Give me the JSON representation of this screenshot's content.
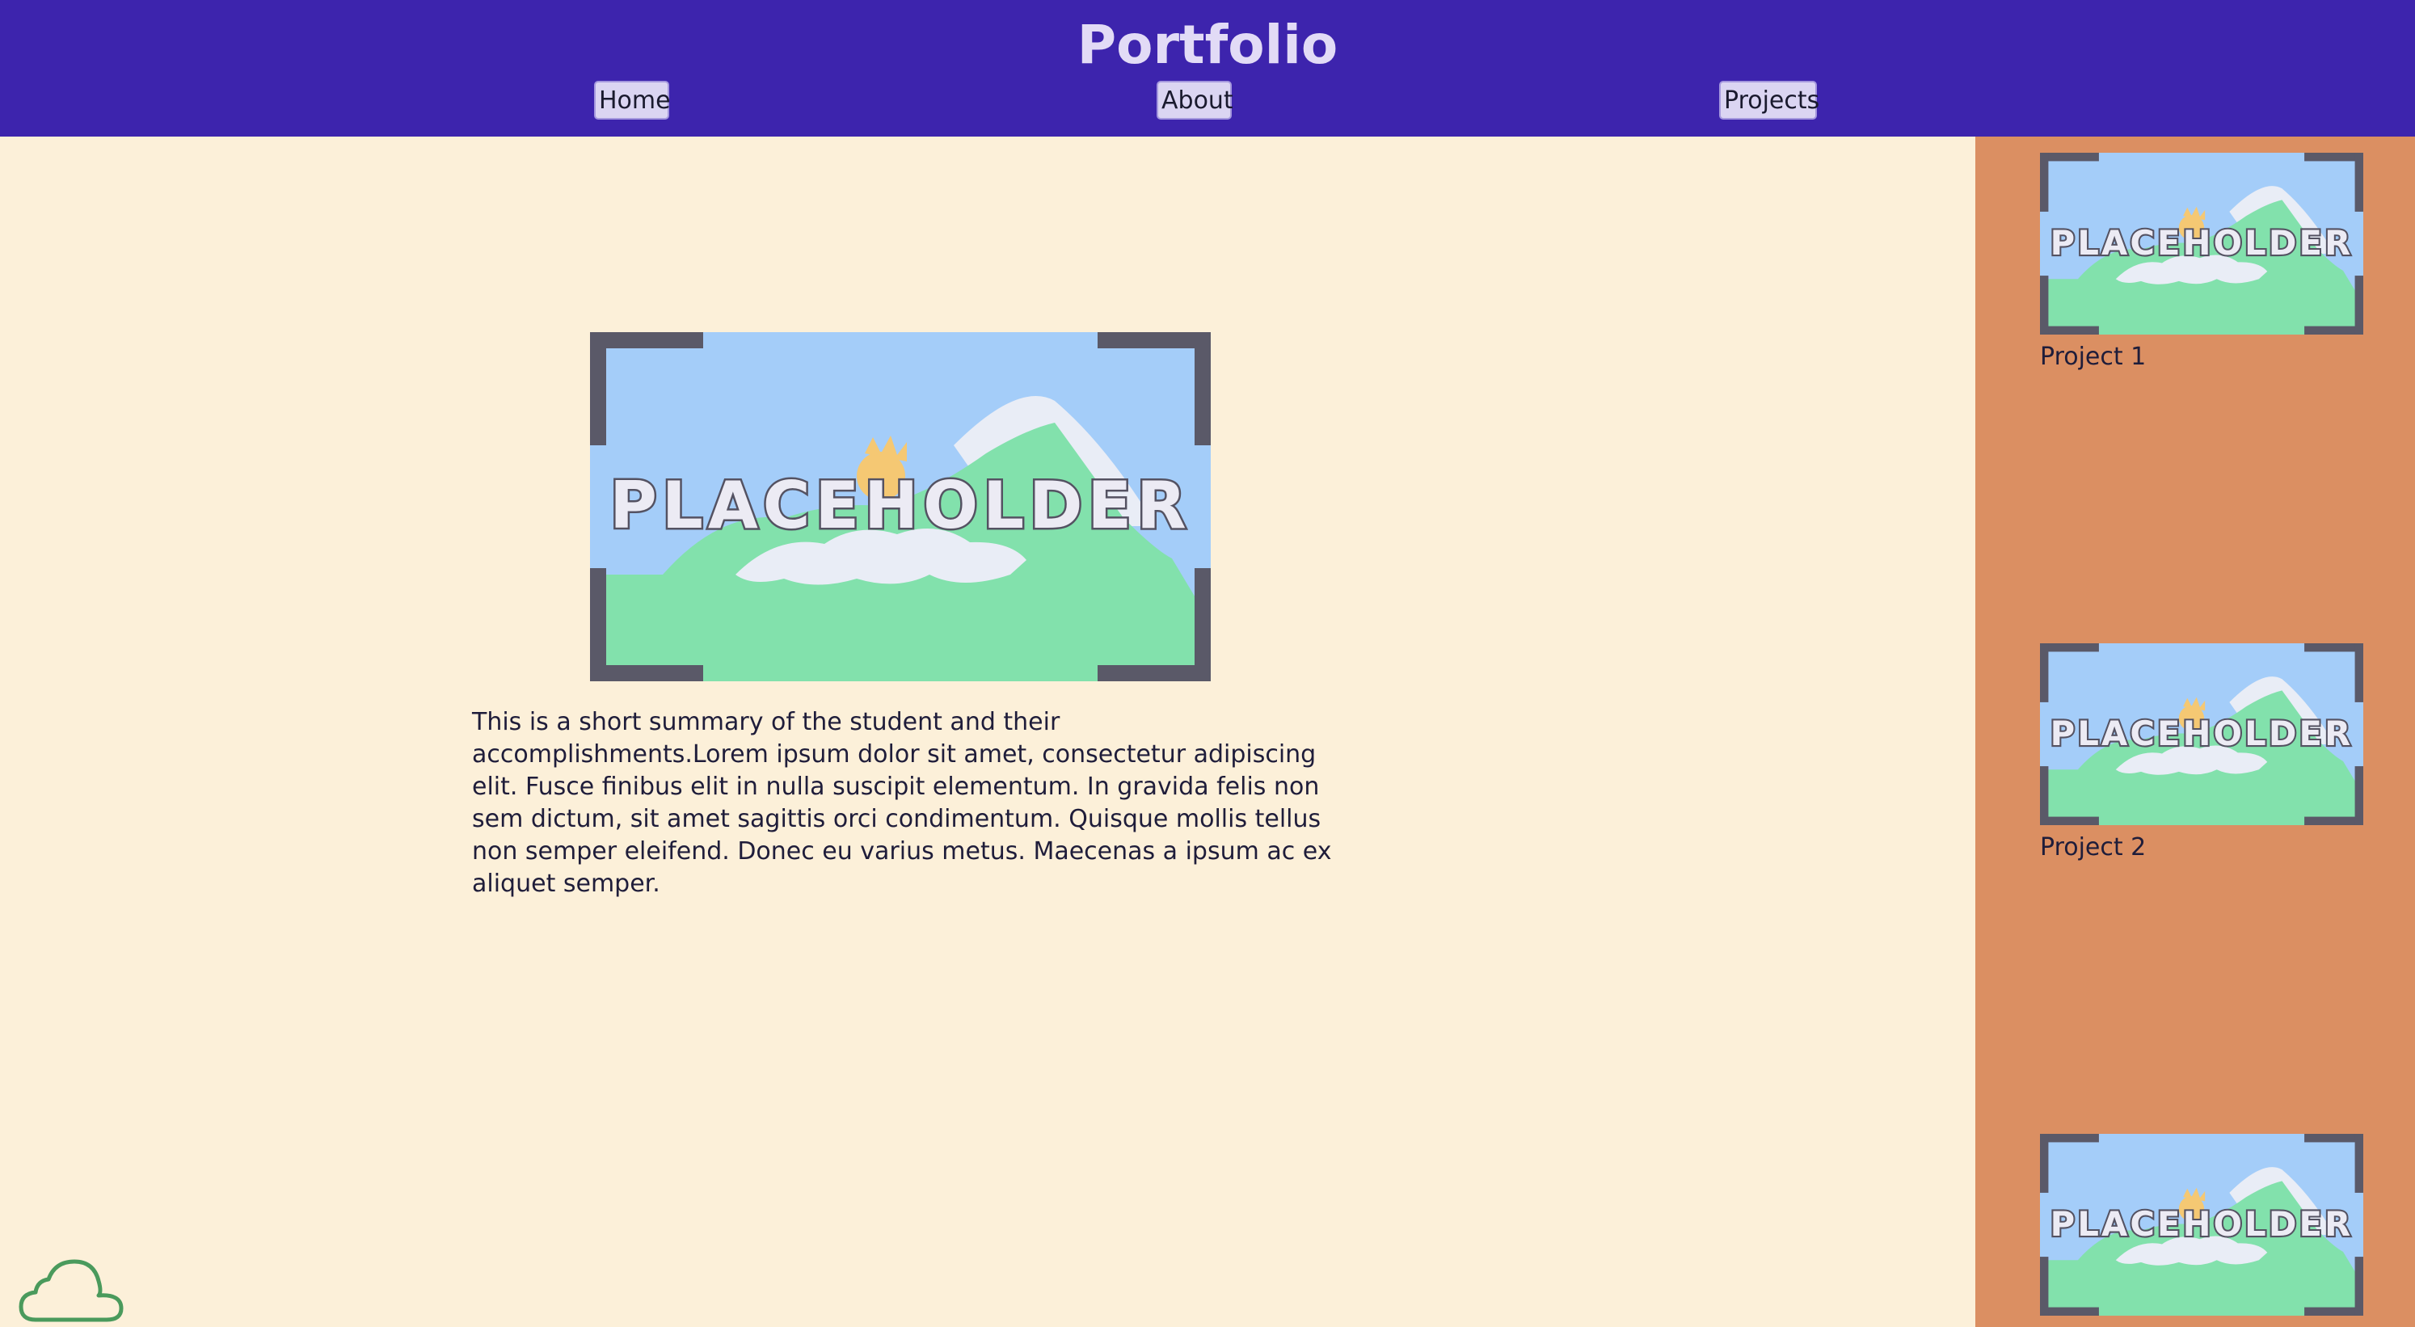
{
  "header": {
    "title": "Portfolio",
    "nav": [
      {
        "label": "Home"
      },
      {
        "label": "About"
      },
      {
        "label": "Projects"
      }
    ]
  },
  "main": {
    "hero_image_text": "PLACEHOLDER",
    "summary": "This is a short summary of the student and their accomplishments.Lorem ipsum dolor sit amet, consectetur adipiscing elit. Fusce finibus elit in nulla suscipit elementum. In gravida felis non sem dictum, sit amet sagittis orci condimentum. Quisque mollis tellus non semper eleifend. Donec eu varius metus. Maecenas a ipsum ac ex aliquet semper."
  },
  "sidebar": {
    "projects": [
      {
        "label": "Project 1",
        "image_text": "PLACEHOLDER"
      },
      {
        "label": "Project 2",
        "image_text": "PLACEHOLDER"
      },
      {
        "label": "",
        "image_text": "PLACEHOLDER"
      }
    ]
  },
  "colors": {
    "header_bg": "#3d24ad",
    "main_bg": "#fcf0d9",
    "sidebar_bg": "#db8f62",
    "title_text": "#e2dbf6",
    "cloud_stroke": "#4a9a5c"
  },
  "icons": {
    "cloud": "cloud-icon"
  }
}
